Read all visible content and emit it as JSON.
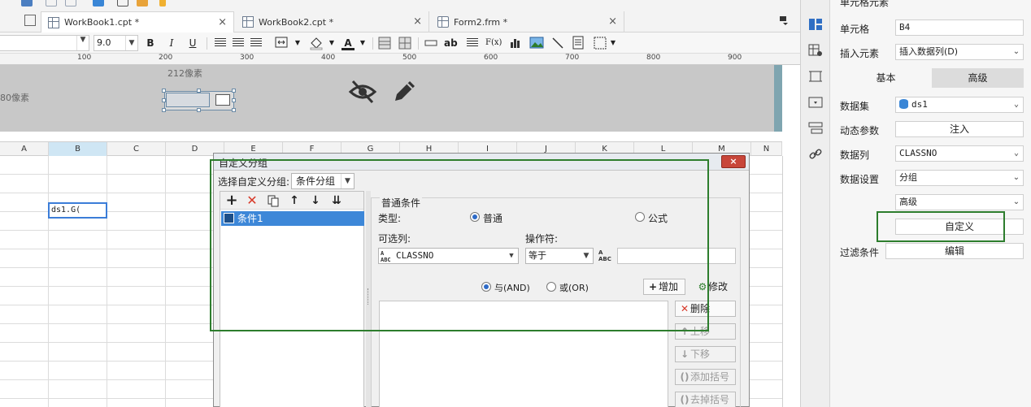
{
  "tabs": [
    {
      "label": "WorkBook1.cpt *",
      "close": "×"
    },
    {
      "label": "WorkBook2.cpt *",
      "close": "×"
    },
    {
      "label": "Form2.frm *",
      "close": "×"
    }
  ],
  "toolbar": {
    "font_size": "9.0",
    "bold": "B",
    "italic": "I",
    "underline": "U",
    "font_color_glyph": "A",
    "text_abc": "ab",
    "formula_glyph": "F(x)"
  },
  "ruler": {
    "marks": [
      "100",
      "200",
      "300",
      "400",
      "500",
      "600",
      "700",
      "800",
      "900"
    ]
  },
  "header_area": {
    "size_label_top": "212像素",
    "size_label_left": "80像素"
  },
  "columns": [
    "A",
    "B",
    "C",
    "D",
    "E",
    "F",
    "G",
    "H",
    "I",
    "J",
    "K",
    "L",
    "M",
    "N"
  ],
  "selected_column": "B",
  "cell": {
    "content": "ds1.G("
  },
  "dialog": {
    "title": "自定义分组",
    "close": "×",
    "select_label": "选择自定义分组:",
    "select_value": "条件分组",
    "conditions": [
      "条件1"
    ],
    "section_title": "普通条件",
    "type_label": "类型:",
    "type_options": [
      "普通",
      "公式"
    ],
    "type_selected": "普通",
    "column_label": "可选列:",
    "column_value": "CLASSNO",
    "operator_label": "操作符:",
    "operator_value": "等于",
    "value_input": "",
    "logic_options": [
      "与(AND)",
      "或(OR)"
    ],
    "logic_selected": "与(AND)",
    "add_label": "增加",
    "modify_label": "修改",
    "delete_label": "删除",
    "up_label": "上移",
    "down_label": "下移",
    "add_bracket_label": "添加括号",
    "remove_bracket_label": "去掉括号"
  },
  "panel": {
    "title": "单元格元素",
    "cell_label": "单元格",
    "cell_value": "B4",
    "insert_label": "插入元素",
    "insert_value": "插入数据列(D)",
    "tab_basic": "基本",
    "tab_advanced": "高级",
    "dataset_label": "数据集",
    "dataset_value": "ds1",
    "dynamic_label": "动态参数",
    "inject_button": "注入",
    "datacol_label": "数据列",
    "datacol_value": "CLASSNO",
    "datasetting_label": "数据设置",
    "datasetting_value": "分组",
    "advanced_value": "高级",
    "custom_button": "自定义",
    "filter_label": "过滤条件",
    "edit_button": "编辑"
  },
  "colors": {
    "highlight_green": "#2d7d2d",
    "selection_blue": "#3d87d8",
    "delete_red": "#d83a2a"
  }
}
